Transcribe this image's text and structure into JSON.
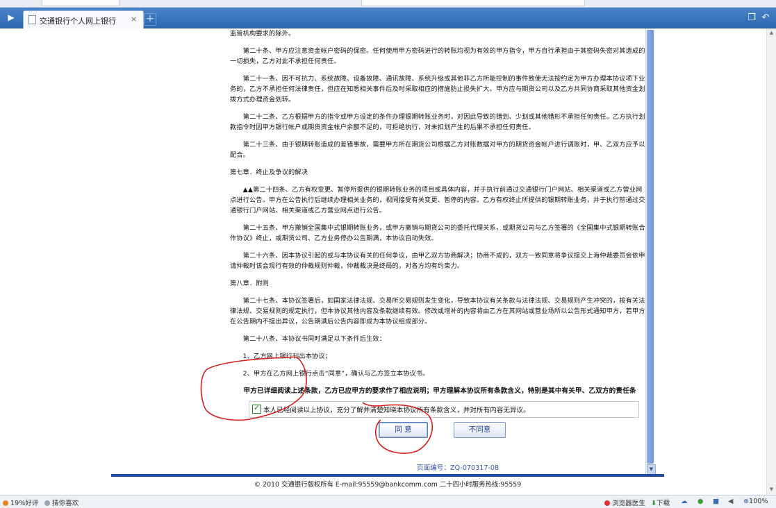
{
  "browser": {
    "tab_title": "交通银行个人网上银行",
    "tab_close": "×",
    "new_tab": "+",
    "tab_nav_icon": "▶",
    "restore_icon": "❐",
    "back_icon": "↶"
  },
  "agreement": {
    "paragraphs": [
      "监管机构要求的除外。",
      "　　第二十条、甲方应注意资金帐户密码的保密。任何使用甲方密码进行的转账均视为有效的甲方指令，甲方自行承担由于其密码失密对其造成的一切损失，乙方对此不承担任何责任。",
      "　　第二十一条、因不可抗力、系统故障、设备故障、通讯故障、系统升级或其他非乙方所能控制的事件致使无法按约定为甲方办理本协议项下业务的，乙方不承担任何法律责任，但应在知悉相关事件后及时采取相应的措施防止损失扩大。甲方应与期货公司以及乙方共同协商采取其他资金划拨方式办理资金划转。",
      "　　第二十二条、乙方根据甲方的指令或甲方设定的条件办理银期转账业务时，对因此导致的错划、少划或其他错形不承担任何责任。乙方执行划款指令时因甲方银行帐户或期货资金帐户余额不足的，可拒绝执行，对未扣划产生的后果不承担任何责任。",
      "　　第二十三条、由于银期转账造成的差错事故，需要甲方所在期货公司根据乙方对账数据对甲方的期货资金帐户进行调账时，甲、乙双方应予以配合。",
      "第七章．终止及争议的解决",
      "　　▲▲第二十四条、乙方有权变更、暂停所提供的银期转账业务的项目或具体内容，并于执行前通过交通银行门户网站、相关渠道或乙方营业网点进行公告。甲方在公告执行后继续办理相关业务的，视同接受有关变更、暂停的内容。乙方有权终止所提供的银期转账业务，并于执行前通过交通银行门户网站、相关渠道或乙方营业网点进行公告。",
      "　　第二十五条、甲方撤销全国集中式银期转账业务，或甲方撤销与期货公司的委托代理关系，或期货公司与乙方签署的《全国集中式银期转账合作协议》终止，或期货公司、乙方业务停办公告期满，本协议自动失效。",
      "　　第二十六条、因本协议引起的或与本协议有关的任何争议，由甲乙双方协商解决；协商不成的，双方一致同意将争议提交上海仲裁委员会依申请仲裁时该会现行有效的仲裁规则仲裁，仲裁裁决是终局的，对各方均有约束力。",
      "第八章．附则",
      "　　第二十七条、本协议签署后，如国家法律法规、交易所交易规则发生变化，导致本协议有关条款与法律法规、交易规则产生冲突的，按有关法律法规、交易规则的规定执行，但本协议其他内容及条款继续有效。修改或增补的内容将由乙方在其网站或营业场所以公告形式通知甲方，若甲方在公告期内不提出异议，公告期满后公告内容即成为本协议组成部分。",
      "　　第二十八条、本协议书同时满足以下条件后生效：",
      "　　1、乙方网上银行刊出本协议；",
      "　　2、甲方在乙方网上银行点击“同意”，确认与乙方签立本协议书。"
    ],
    "bold_statement": "　　甲方已详细阅读上述条款，乙方已应甲方的要求作了相应说明；甲方理解本协议所有条款含义，特别是其中有关甲、乙双方的责任条款，并对所有内容无异议。"
  },
  "confirm": {
    "checkbox_checked": true,
    "checkbox_label": "本人已经阅读以上协议，充分了解并清楚知晓本协议所有条款含义，并对所有内容无异议。",
    "agree_label": "同 意",
    "disagree_label": "不同意"
  },
  "page_number": "页面编号：ZQ-070317-08",
  "footer": "© 2010 交通银行版权所有 E-mail:95559@bankcomm.com 二十四小时服务热线:95559",
  "statusbar": {
    "left_1": "19%好评",
    "left_2": "猜你喜欢",
    "doctor": "浏览器医生",
    "download": "下载",
    "zoom": "100%"
  },
  "colors": {
    "tabbar": "#3a76bd",
    "footer_line": "#1e4aa0",
    "annotation_red": "#d81e1e"
  }
}
